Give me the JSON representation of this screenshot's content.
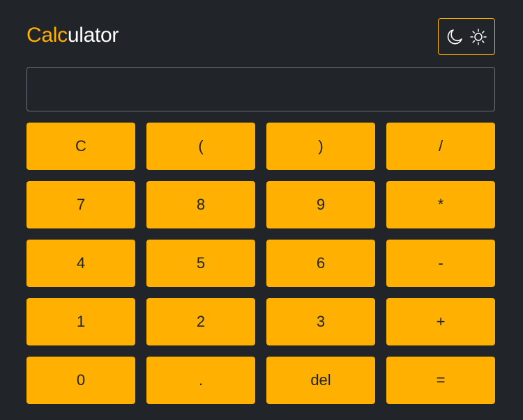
{
  "header": {
    "title_accent": "Calc",
    "title_rest": "ulator",
    "theme_toggle": {
      "icons": [
        "moon-icon",
        "sun-icon"
      ],
      "border_color": "#ffb000"
    }
  },
  "display": {
    "value": "",
    "placeholder": ""
  },
  "colors": {
    "background": "#212529",
    "accent": "#ffb000",
    "key_text": "#212529",
    "title_text": "#ffffff"
  },
  "keypad": {
    "keys": [
      {
        "label": "C",
        "name": "clear-button"
      },
      {
        "label": "(",
        "name": "open-paren-button"
      },
      {
        "label": ")",
        "name": "close-paren-button"
      },
      {
        "label": "/",
        "name": "divide-button"
      },
      {
        "label": "7",
        "name": "digit-7-button"
      },
      {
        "label": "8",
        "name": "digit-8-button"
      },
      {
        "label": "9",
        "name": "digit-9-button"
      },
      {
        "label": "*",
        "name": "multiply-button"
      },
      {
        "label": "4",
        "name": "digit-4-button"
      },
      {
        "label": "5",
        "name": "digit-5-button"
      },
      {
        "label": "6",
        "name": "digit-6-button"
      },
      {
        "label": "-",
        "name": "subtract-button"
      },
      {
        "label": "1",
        "name": "digit-1-button"
      },
      {
        "label": "2",
        "name": "digit-2-button"
      },
      {
        "label": "3",
        "name": "digit-3-button"
      },
      {
        "label": "+",
        "name": "add-button"
      },
      {
        "label": "0",
        "name": "digit-0-button"
      },
      {
        "label": ".",
        "name": "decimal-button"
      },
      {
        "label": "del",
        "name": "delete-button"
      },
      {
        "label": "=",
        "name": "equals-button"
      }
    ]
  }
}
